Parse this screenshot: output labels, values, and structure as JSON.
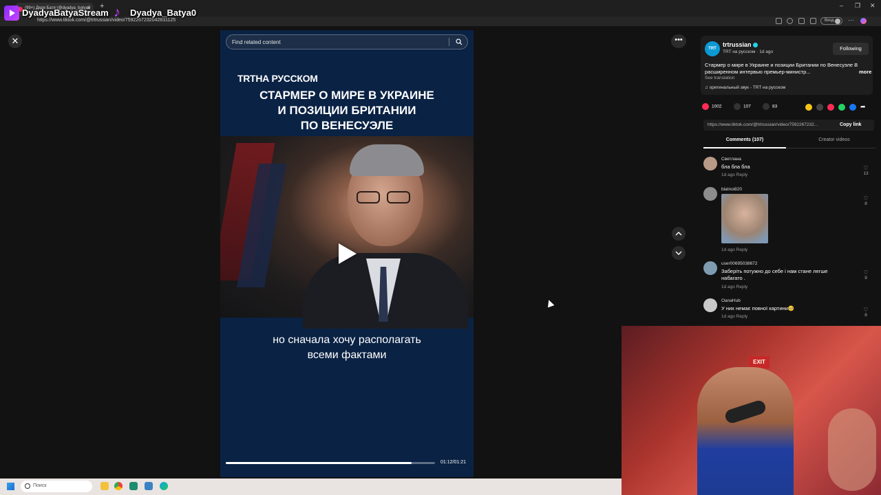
{
  "browser": {
    "tab_title": "(99+) Дядя Батя (@dyadya_batya0",
    "url": "https://www.tiktok.com/@trtrussian/video/7592267232042831125",
    "profile_label": "Вход"
  },
  "stream_overlay": {
    "channel_1": "DyadyaBatyaStream",
    "channel_2": "Dyadya_Batya0"
  },
  "video": {
    "search_placeholder": "Find related content",
    "brand": "TRTНА РУССКОМ",
    "headline_lines": [
      "СТАРМЕР О МИРЕ В УКРАИНЕ",
      "И ПОЗИЦИИ БРИТАНИИ",
      "ПО ВЕНЕСУЭЛЕ"
    ],
    "subtitle_lines": [
      "но сначала хочу располагать",
      "всеми фактами"
    ],
    "time": "01:12/01:21",
    "progress_fraction": 0.889
  },
  "author": {
    "name": "trtrussian",
    "avatar_text": "TRT",
    "subline": "TRT на русском · 1d ago",
    "follow_label": "Following",
    "description": "Стармер о мире в Украине и позиции Британии по Венесуэле В расширенном интервью премьер-министр...",
    "more_label": "more",
    "see_translation": "See translation",
    "sound": "♫  оригинальный звук - TRT на русском"
  },
  "stats": {
    "likes": "1002",
    "comments": "107",
    "saves": "83"
  },
  "share": {
    "link": "https://www.tiktok.com/@trtrussian/video/7592267232...",
    "copy_label": "Copy link"
  },
  "tabs": {
    "comments": "Comments (107)",
    "creator_videos": "Creator videos"
  },
  "comments": [
    {
      "user": "Светлана",
      "text": "бла бла бла",
      "meta": "1d ago     Reply",
      "likes": "13",
      "avatar_color": "#b89a88"
    },
    {
      "user": "blatnoi820",
      "text": "",
      "meta": "1d ago     Reply",
      "likes": "8",
      "avatar_color": "#8c8c8c",
      "has_image": true
    },
    {
      "user": "user00695038672",
      "text": "Заберіть потужно до себе і нам стане легше набагато .",
      "meta": "1d ago     Reply",
      "likes": "9",
      "avatar_color": "#7e9bb0"
    },
    {
      "user": "OanaHub",
      "text": "У них немає повної картини🥺",
      "meta": "1d ago     Reply",
      "likes": "8",
      "avatar_color": "#c9c9c9"
    }
  ],
  "taskbar": {
    "search_placeholder": "Поиск"
  },
  "colors": {
    "accent_red": "#fe2c55",
    "video_bg": "#0a2244",
    "verified": "#20d5ec"
  }
}
